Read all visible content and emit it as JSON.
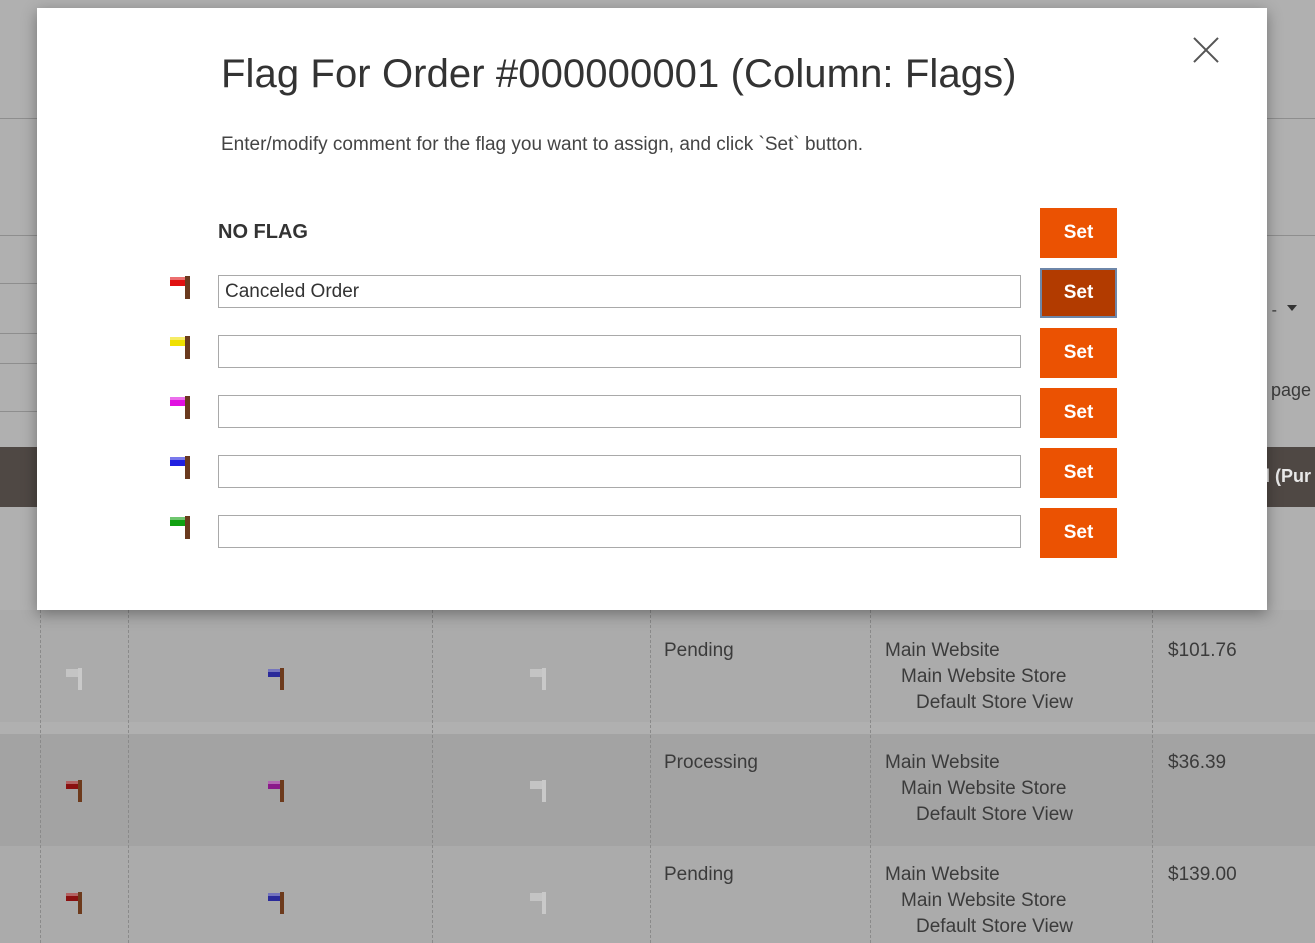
{
  "modal": {
    "title": "Flag For Order #000000001 (Column: Flags)",
    "description": "Enter/modify comment for the flag you want to assign, and click `Set` button.",
    "close_icon": "close-icon",
    "no_flag_label": "NO FLAG",
    "set_label": "Set",
    "flags": [
      {
        "color_name": "red",
        "color": "#e01010",
        "comment": "Canceled Order",
        "active": true
      },
      {
        "color_name": "yellow",
        "color": "#f0e000",
        "comment": "",
        "active": false
      },
      {
        "color_name": "magenta",
        "color": "#e010e0",
        "comment": "",
        "active": false
      },
      {
        "color_name": "blue",
        "color": "#2020e0",
        "comment": "",
        "active": false
      },
      {
        "color_name": "green",
        "color": "#10a010",
        "comment": "",
        "active": false
      }
    ]
  },
  "background": {
    "header_partial": "l (Pur",
    "per_page_partial": "r page",
    "caret_dash": "-",
    "rows": [
      {
        "flag1_color": "",
        "flag2_color": "#2a2a9a",
        "status": "Pending",
        "website": "Main Website",
        "store": "Main Website Store",
        "view": "Default Store View",
        "amount": "$101.76"
      },
      {
        "flag1_color": "#8a1010",
        "flag2_color": "#8a1a8a",
        "status": "Processing",
        "website": "Main Website",
        "store": "Main Website Store",
        "view": "Default Store View",
        "amount": "$36.39"
      },
      {
        "flag1_color": "#8a1010",
        "flag2_color": "#2a2a9a",
        "status": "Pending",
        "website": "Main Website",
        "store": "Main Website Store",
        "view": "Default Store View",
        "amount": "$139.00"
      }
    ]
  }
}
